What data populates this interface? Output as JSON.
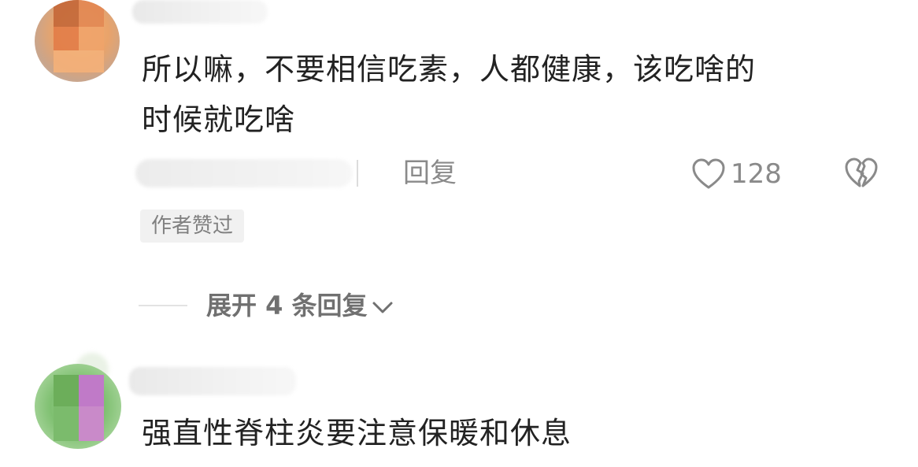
{
  "comments": [
    {
      "text_line1": "所以嘛，不要相信吃素，人都健康，该吃啥的",
      "text_line2": "时候就吃啥",
      "reply_label": "回复",
      "like_count": "128",
      "author_badge": "作者赞过",
      "expand_label": "展开 4 条回复"
    },
    {
      "text_line1": "强直性脊柱炎要注意保暖和休息"
    }
  ],
  "icons": {
    "like": "heart-outline-icon",
    "dislike": "broken-heart-icon",
    "expand": "chevron-down-icon"
  },
  "colors": {
    "text_primary": "#222222",
    "text_secondary": "#8a8a8a",
    "badge_bg": "#f1f1f1"
  }
}
